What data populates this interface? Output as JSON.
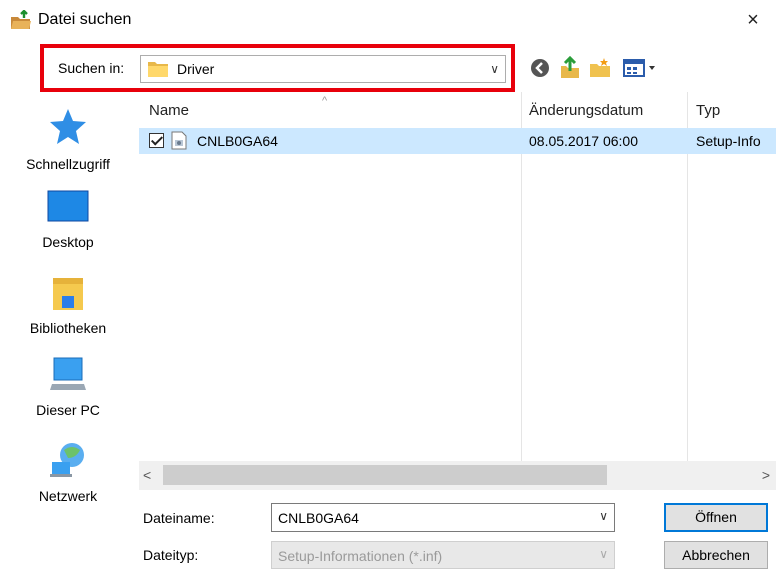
{
  "window": {
    "title": "Datei suchen",
    "close_glyph": "×"
  },
  "location": {
    "label": "Suchen in:",
    "value": "Driver",
    "dropdown_glyph": "∨",
    "toolbar_icons": [
      "back-icon",
      "up-folder-icon",
      "new-folder-icon",
      "view-menu-icon"
    ]
  },
  "places": [
    {
      "label": "Schnellzugriff",
      "icon": "quick-access-star-icon"
    },
    {
      "label": "Desktop",
      "icon": "desktop-icon"
    },
    {
      "label": "Bibliotheken",
      "icon": "libraries-icon"
    },
    {
      "label": "Dieser PC",
      "icon": "this-pc-icon"
    },
    {
      "label": "Netzwerk",
      "icon": "network-icon"
    }
  ],
  "filelist": {
    "columns": [
      "Name",
      "Änderungsdatum",
      "Typ"
    ],
    "sort_glyph": "^",
    "rows": [
      {
        "name": "CNLB0GA64",
        "date": "08.05.2017 06:00",
        "type": "Setup-Info",
        "checked": true,
        "selected": true
      }
    ],
    "scroll_left_glyph": "<",
    "scroll_right_glyph": ">"
  },
  "bottom": {
    "filename_label": "Dateiname:",
    "filename_value": "CNLB0GA64",
    "filetype_label": "Dateityp:",
    "filetype_value": "Setup-Informationen (*.inf)",
    "dropdown_glyph": "∨",
    "open_label": "Öffnen",
    "cancel_label": "Abbrechen"
  },
  "colors": {
    "highlight_border": "#e8000b",
    "selection": "#cce8ff",
    "default_button_border": "#0078d7"
  }
}
